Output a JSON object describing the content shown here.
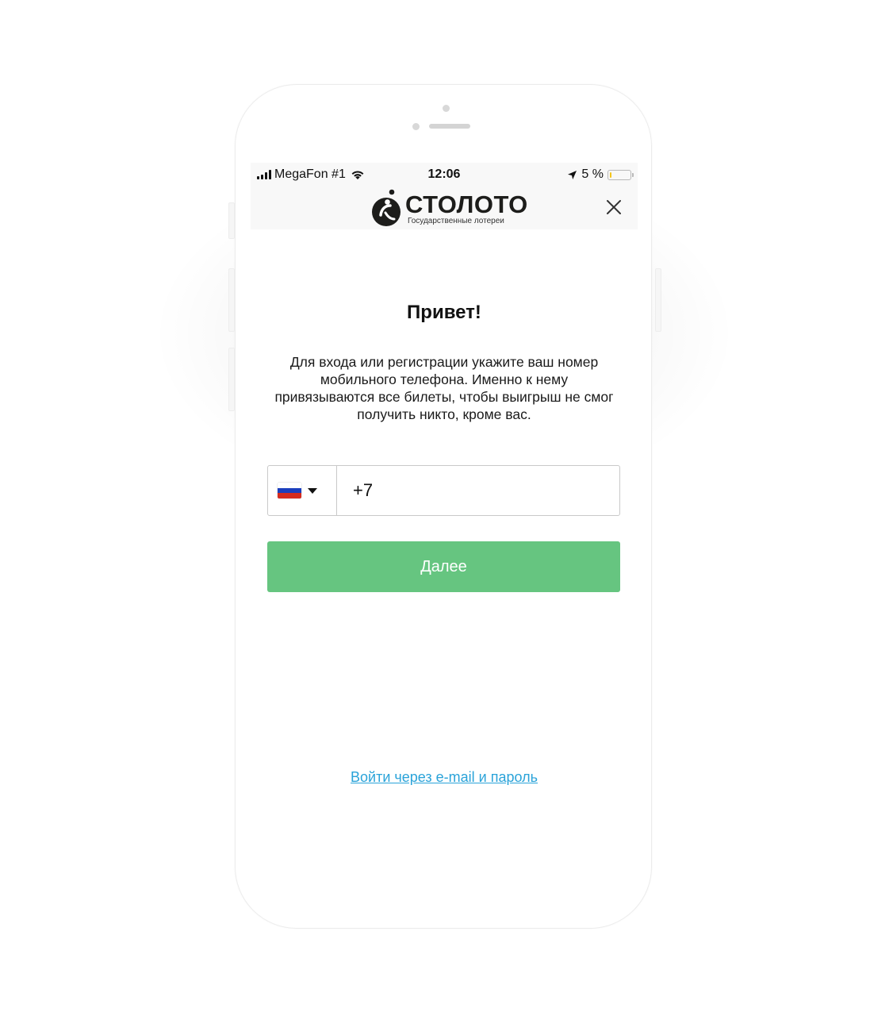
{
  "status_bar": {
    "carrier": "MegaFon #1",
    "time": "12:06",
    "battery_text": "5 %",
    "battery_level": 0.05
  },
  "header": {
    "logo_word": "СТОЛОТО",
    "logo_tagline": "Государственные лотереи",
    "close_icon": "close-icon"
  },
  "main": {
    "title": "Привет!",
    "description": "Для входа или регистрации укажите ваш номер мобильного телефона. Именно к нему привязываются все билеты, чтобы выигрыш не смог получить никто, кроме вас.",
    "phone": {
      "country_flag": "russia-flag",
      "value": "+7"
    },
    "next_button": "Далее",
    "email_login_link": "Войти через e-mail и пароль"
  },
  "colors": {
    "accent_green": "#66c580",
    "link_blue": "#2aa3d9",
    "battery_low": "#f4c51b"
  }
}
